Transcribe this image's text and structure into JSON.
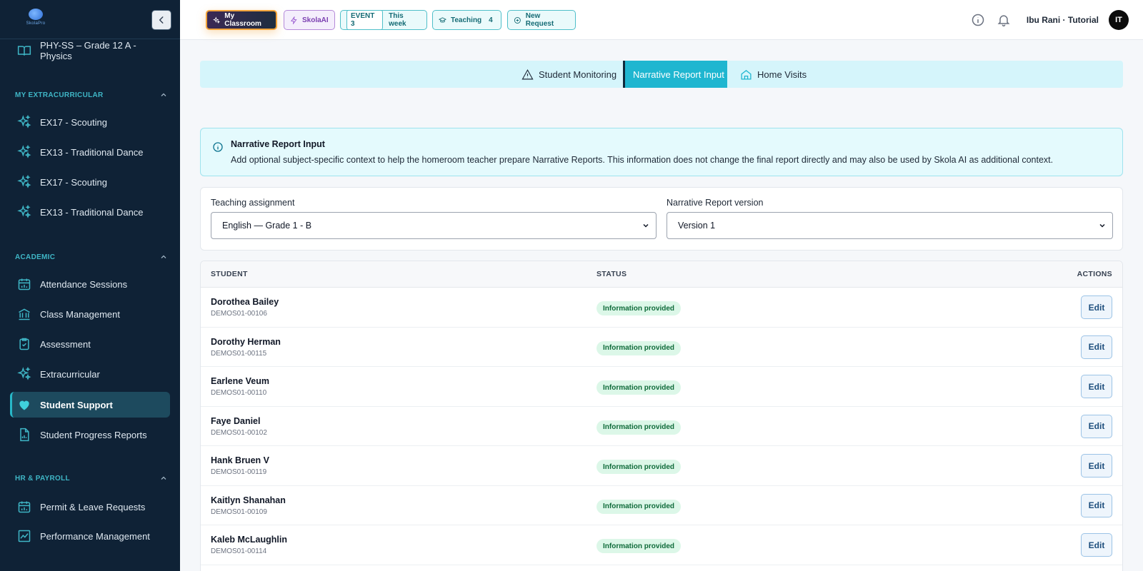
{
  "logo": {
    "word": "SkolaPro"
  },
  "sidebar": {
    "top_item": "PHY-SS – Grade 12 A - Physics",
    "sections": [
      {
        "label": "MY EXTRACURRICULAR"
      },
      {
        "label": "ACADEMIC"
      },
      {
        "label": "HR & PAYROLL"
      }
    ],
    "extracurricular": [
      "EX17 - Scouting",
      "EX13 - Traditional Dance",
      "EX17 - Scouting",
      "EX13 - Traditional Dance"
    ],
    "academic": [
      {
        "label": "Attendance Sessions",
        "icon": "calendar-chart-icon"
      },
      {
        "label": "Class Management",
        "icon": "bank-icon"
      },
      {
        "label": "Assessment",
        "icon": "clipboard-check-icon"
      },
      {
        "label": "Extracurricular",
        "icon": "sparkles-icon"
      },
      {
        "label": "Student Support",
        "icon": "heart-icon",
        "active": true
      },
      {
        "label": "Student Progress Reports",
        "icon": "file-chart-icon"
      }
    ],
    "hr": [
      {
        "label": "Permit & Leave Requests",
        "icon": "calendar-chart-icon"
      },
      {
        "label": "Performance Management",
        "icon": "trend-chart-icon"
      }
    ]
  },
  "topbar": {
    "my_classroom": "My Classroom",
    "skolaai": "SkolaAI",
    "event_tag": "EVENT 3",
    "event_label": "This week",
    "teaching_label": "Teaching",
    "teaching_count": "4",
    "new_request": "New Request",
    "user_name": "Ibu Rani · Tutorial",
    "avatar_initials": "IT"
  },
  "tabs": {
    "monitoring": "Student Monitoring",
    "narrative": "Narrative Report Input",
    "home_visits": "Home Visits"
  },
  "info": {
    "title": "Narrative Report Input",
    "body": "Add optional subject-specific context to help the homeroom teacher prepare Narrative Reports. This information does not change the final report directly and may also be used by Skola AI as additional context."
  },
  "selectors": {
    "assignment_label": "Teaching assignment",
    "assignment_value": "English — Grade 1 - B",
    "version_label": "Narrative Report version",
    "version_value": "Version 1"
  },
  "table": {
    "headers": {
      "student": "STUDENT",
      "status": "STATUS",
      "actions": "ACTIONS"
    },
    "edit_label": "Edit",
    "rows": [
      {
        "name": "Dorothea Bailey",
        "id": "DEMOS01-00106",
        "status": "Information provided"
      },
      {
        "name": "Dorothy Herman",
        "id": "DEMOS01-00115",
        "status": "Information provided"
      },
      {
        "name": "Earlene Veum",
        "id": "DEMOS01-00110",
        "status": "Information provided"
      },
      {
        "name": "Faye Daniel",
        "id": "DEMOS01-00102",
        "status": "Information provided"
      },
      {
        "name": "Hank Bruen V",
        "id": "DEMOS01-00119",
        "status": "Information provided"
      },
      {
        "name": "Kaitlyn Shanahan",
        "id": "DEMOS01-00109",
        "status": "Information provided"
      },
      {
        "name": "Kaleb McLaughlin",
        "id": "DEMOS01-00114",
        "status": "Information provided"
      }
    ]
  },
  "colors": {
    "sidebar_bg": "#0f2236",
    "accent": "#1fb6d0",
    "badge_bg": "#dcf7e8",
    "badge_text": "#0f6b3a"
  }
}
